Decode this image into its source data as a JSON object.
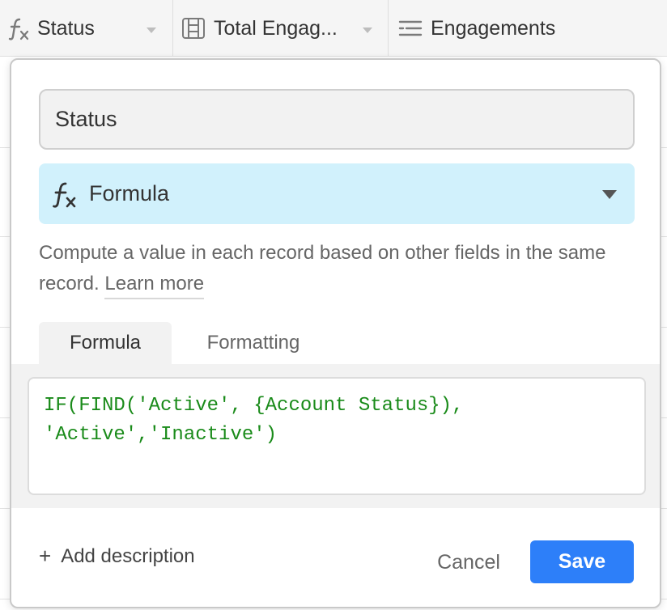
{
  "grid": {
    "columns": [
      {
        "label": "Status",
        "icon": "formula-icon"
      },
      {
        "label": "Total Engag...",
        "icon": "rollup-icon"
      },
      {
        "label": "Engagements",
        "icon": "linked-list-icon"
      }
    ]
  },
  "dialog": {
    "field_name": "Status",
    "field_type": "Formula",
    "description": "Compute a value in each record based on other fields in the same record.",
    "learn_more": "Learn more",
    "tabs": [
      {
        "label": "Formula",
        "active": true
      },
      {
        "label": "Formatting",
        "active": false
      }
    ],
    "formula": "IF(FIND('Active', {Account Status}),\n'Active','Inactive')",
    "add_description": "Add description",
    "cancel_label": "Cancel",
    "save_label": "Save"
  },
  "colors": {
    "accent": "#2d7ff9",
    "type_select_bg": "#d1f1fc",
    "formula_text": "#1a8b1a"
  }
}
